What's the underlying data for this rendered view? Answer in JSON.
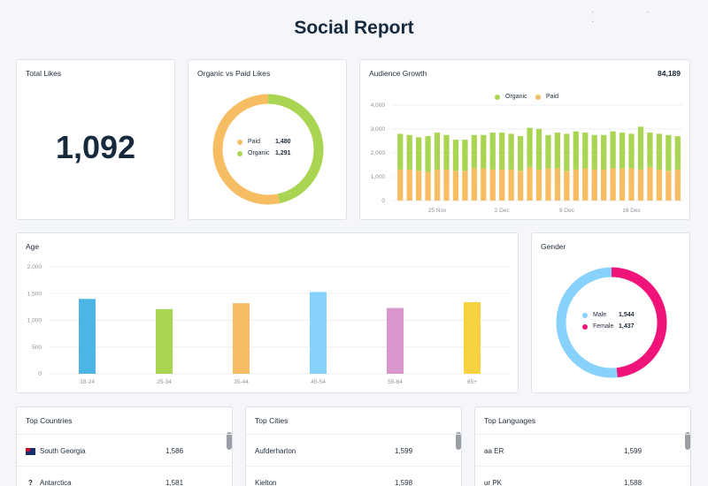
{
  "page": {
    "title": "Social Report"
  },
  "total_likes": {
    "label": "Total Likes",
    "value": "1,092"
  },
  "organic_vs_paid": {
    "label": "Organic vs Paid Likes",
    "legend": [
      {
        "name": "Paid",
        "value": "1,480",
        "color": "#f7bd62"
      },
      {
        "name": "Organic",
        "value": "1,291",
        "color": "#a9d552"
      }
    ],
    "chart_data": {
      "type": "pie",
      "labels": [
        "Paid",
        "Organic"
      ],
      "values": [
        1480,
        1291
      ],
      "colors": [
        "#f7bd62",
        "#a9d552"
      ]
    }
  },
  "audience_growth": {
    "label": "Audience Growth",
    "total": "84,189",
    "legend": [
      {
        "name": "Organic",
        "color": "#a9d552"
      },
      {
        "name": "Paid",
        "color": "#f7bd62"
      }
    ],
    "chart_data": {
      "type": "bar",
      "stacked": true,
      "ylim": [
        0,
        4000
      ],
      "yticks": [
        "4,000",
        "3,000",
        "2,000",
        "1,000",
        "0"
      ],
      "ytick_values": [
        4000,
        3000,
        2000,
        1000,
        0
      ],
      "xtick_labels": [
        "25 Nov",
        "2 Dec",
        "9 Dec",
        "16 Dec"
      ],
      "xtick_bar_index": [
        4,
        11,
        18,
        25
      ],
      "series": [
        {
          "name": "Paid",
          "color": "#f7bd62",
          "values": [
            1300,
            1300,
            1250,
            1200,
            1300,
            1300,
            1250,
            1250,
            1350,
            1350,
            1300,
            1300,
            1300,
            1250,
            1400,
            1300,
            1350,
            1350,
            1250,
            1300,
            1350,
            1300,
            1300,
            1350,
            1350,
            1350,
            1300,
            1400,
            1300,
            1250,
            1300
          ]
        },
        {
          "name": "Organic",
          "color": "#a9d552",
          "values": [
            1500,
            1450,
            1400,
            1500,
            1550,
            1450,
            1300,
            1300,
            1400,
            1400,
            1550,
            1550,
            1500,
            1450,
            1650,
            1700,
            1400,
            1500,
            1550,
            1600,
            1500,
            1450,
            1450,
            1550,
            1500,
            1450,
            1800,
            1450,
            1500,
            1500,
            1400
          ]
        }
      ]
    }
  },
  "age": {
    "label": "Age",
    "chart_data": {
      "type": "bar",
      "categories": [
        "18-24",
        "25-34",
        "35-44",
        "45-54",
        "55-64",
        "65+"
      ],
      "values": [
        1400,
        1210,
        1320,
        1530,
        1230,
        1340
      ],
      "colors": [
        "#4db5e6",
        "#a9d552",
        "#f7bd62",
        "#86d2fc",
        "#d896cc",
        "#f6d241"
      ],
      "ylim": [
        0,
        2000
      ],
      "yticks": [
        "2,000",
        "1,500",
        "1,000",
        "500",
        "0"
      ],
      "ytick_values": [
        2000,
        1500,
        1000,
        500,
        0
      ]
    }
  },
  "gender": {
    "label": "Gender",
    "legend": [
      {
        "name": "Male",
        "value": "1,544",
        "color": "#86d2fc"
      },
      {
        "name": "Female",
        "value": "1,437",
        "color": "#f0147a"
      }
    ],
    "chart_data": {
      "type": "pie",
      "labels": [
        "Male",
        "Female"
      ],
      "values": [
        1544,
        1437
      ],
      "colors": [
        "#86d2fc",
        "#f0147a"
      ]
    }
  },
  "top_countries": {
    "label": "Top Countries",
    "rows": [
      {
        "name": "South Georgia",
        "value": "1,586"
      },
      {
        "name": "Antarctica",
        "value": "1,581"
      }
    ]
  },
  "top_cities": {
    "label": "Top Cities",
    "rows": [
      {
        "name": "Aufderharton",
        "value": "1,599"
      },
      {
        "name": "Kielton",
        "value": "1,598"
      }
    ]
  },
  "top_languages": {
    "label": "Top Languages",
    "rows": [
      {
        "name": "aa ER",
        "value": "1,599"
      },
      {
        "name": "ur PK",
        "value": "1,588"
      }
    ]
  }
}
